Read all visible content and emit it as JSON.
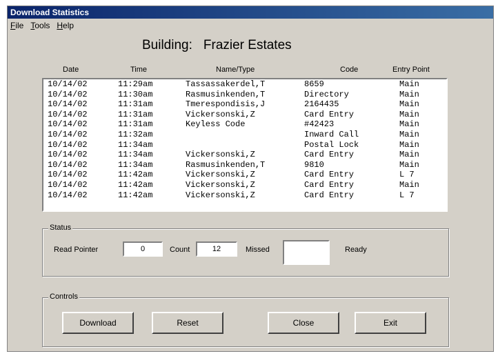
{
  "window": {
    "title": "Download Statistics"
  },
  "menu": [
    {
      "first": "F",
      "rest": "ile"
    },
    {
      "first": "T",
      "rest": "ools"
    },
    {
      "first": "H",
      "rest": "elp"
    }
  ],
  "building": {
    "label": "Building:",
    "name": "Frazier Estates"
  },
  "columns": [
    "Date",
    "Time",
    "Name/Type",
    "Code",
    "Entry Point"
  ],
  "rows": [
    {
      "date": "10/14/02",
      "time": "11:29am",
      "name": "Tassassakerdel,T",
      "code": "8659",
      "entry": "Main"
    },
    {
      "date": "10/14/02",
      "time": "11:30am",
      "name": "Rasmusinkenden,T",
      "code": "Directory",
      "entry": "Main"
    },
    {
      "date": "10/14/02",
      "time": "11:31am",
      "name": "Tmerespondisis,J",
      "code": "2164435",
      "entry": "Main"
    },
    {
      "date": "10/14/02",
      "time": "11:31am",
      "name": "Vickersonski,Z",
      "code": "Card Entry",
      "entry": "Main"
    },
    {
      "date": "10/14/02",
      "time": "11:31am",
      "name": "Keyless Code",
      "code": "#42423",
      "entry": "Main"
    },
    {
      "date": "10/14/02",
      "time": "11:32am",
      "name": "",
      "code": "Inward Call",
      "entry": "Main"
    },
    {
      "date": "10/14/02",
      "time": "11:34am",
      "name": "",
      "code": "Postal Lock",
      "entry": "Main"
    },
    {
      "date": "10/14/02",
      "time": "11:34am",
      "name": "Vickersonski,Z",
      "code": "Card Entry",
      "entry": "Main"
    },
    {
      "date": "10/14/02",
      "time": "11:34am",
      "name": "Rasmusinkenden,T",
      "code": "9810",
      "entry": "Main"
    },
    {
      "date": "10/14/02",
      "time": "11:42am",
      "name": "Vickersonski,Z",
      "code": "Card Entry",
      "entry": "L 7"
    },
    {
      "date": "10/14/02",
      "time": "11:42am",
      "name": "Vickersonski,Z",
      "code": "Card Entry",
      "entry": "Main"
    },
    {
      "date": "10/14/02",
      "time": "11:42am",
      "name": "Vickersonski,Z",
      "code": "Card Entry",
      "entry": "L 7"
    }
  ],
  "status": {
    "title": "Status",
    "read_pointer_label": "Read Pointer",
    "read_pointer_value": "0",
    "count_label": "Count",
    "count_value": "12",
    "missed_label": "Missed",
    "missed_value": "",
    "state_text": "Ready"
  },
  "controls": {
    "title": "Controls",
    "download_label": "Download",
    "reset_label": "Reset",
    "close_label": "Close",
    "exit_label": "Exit"
  }
}
